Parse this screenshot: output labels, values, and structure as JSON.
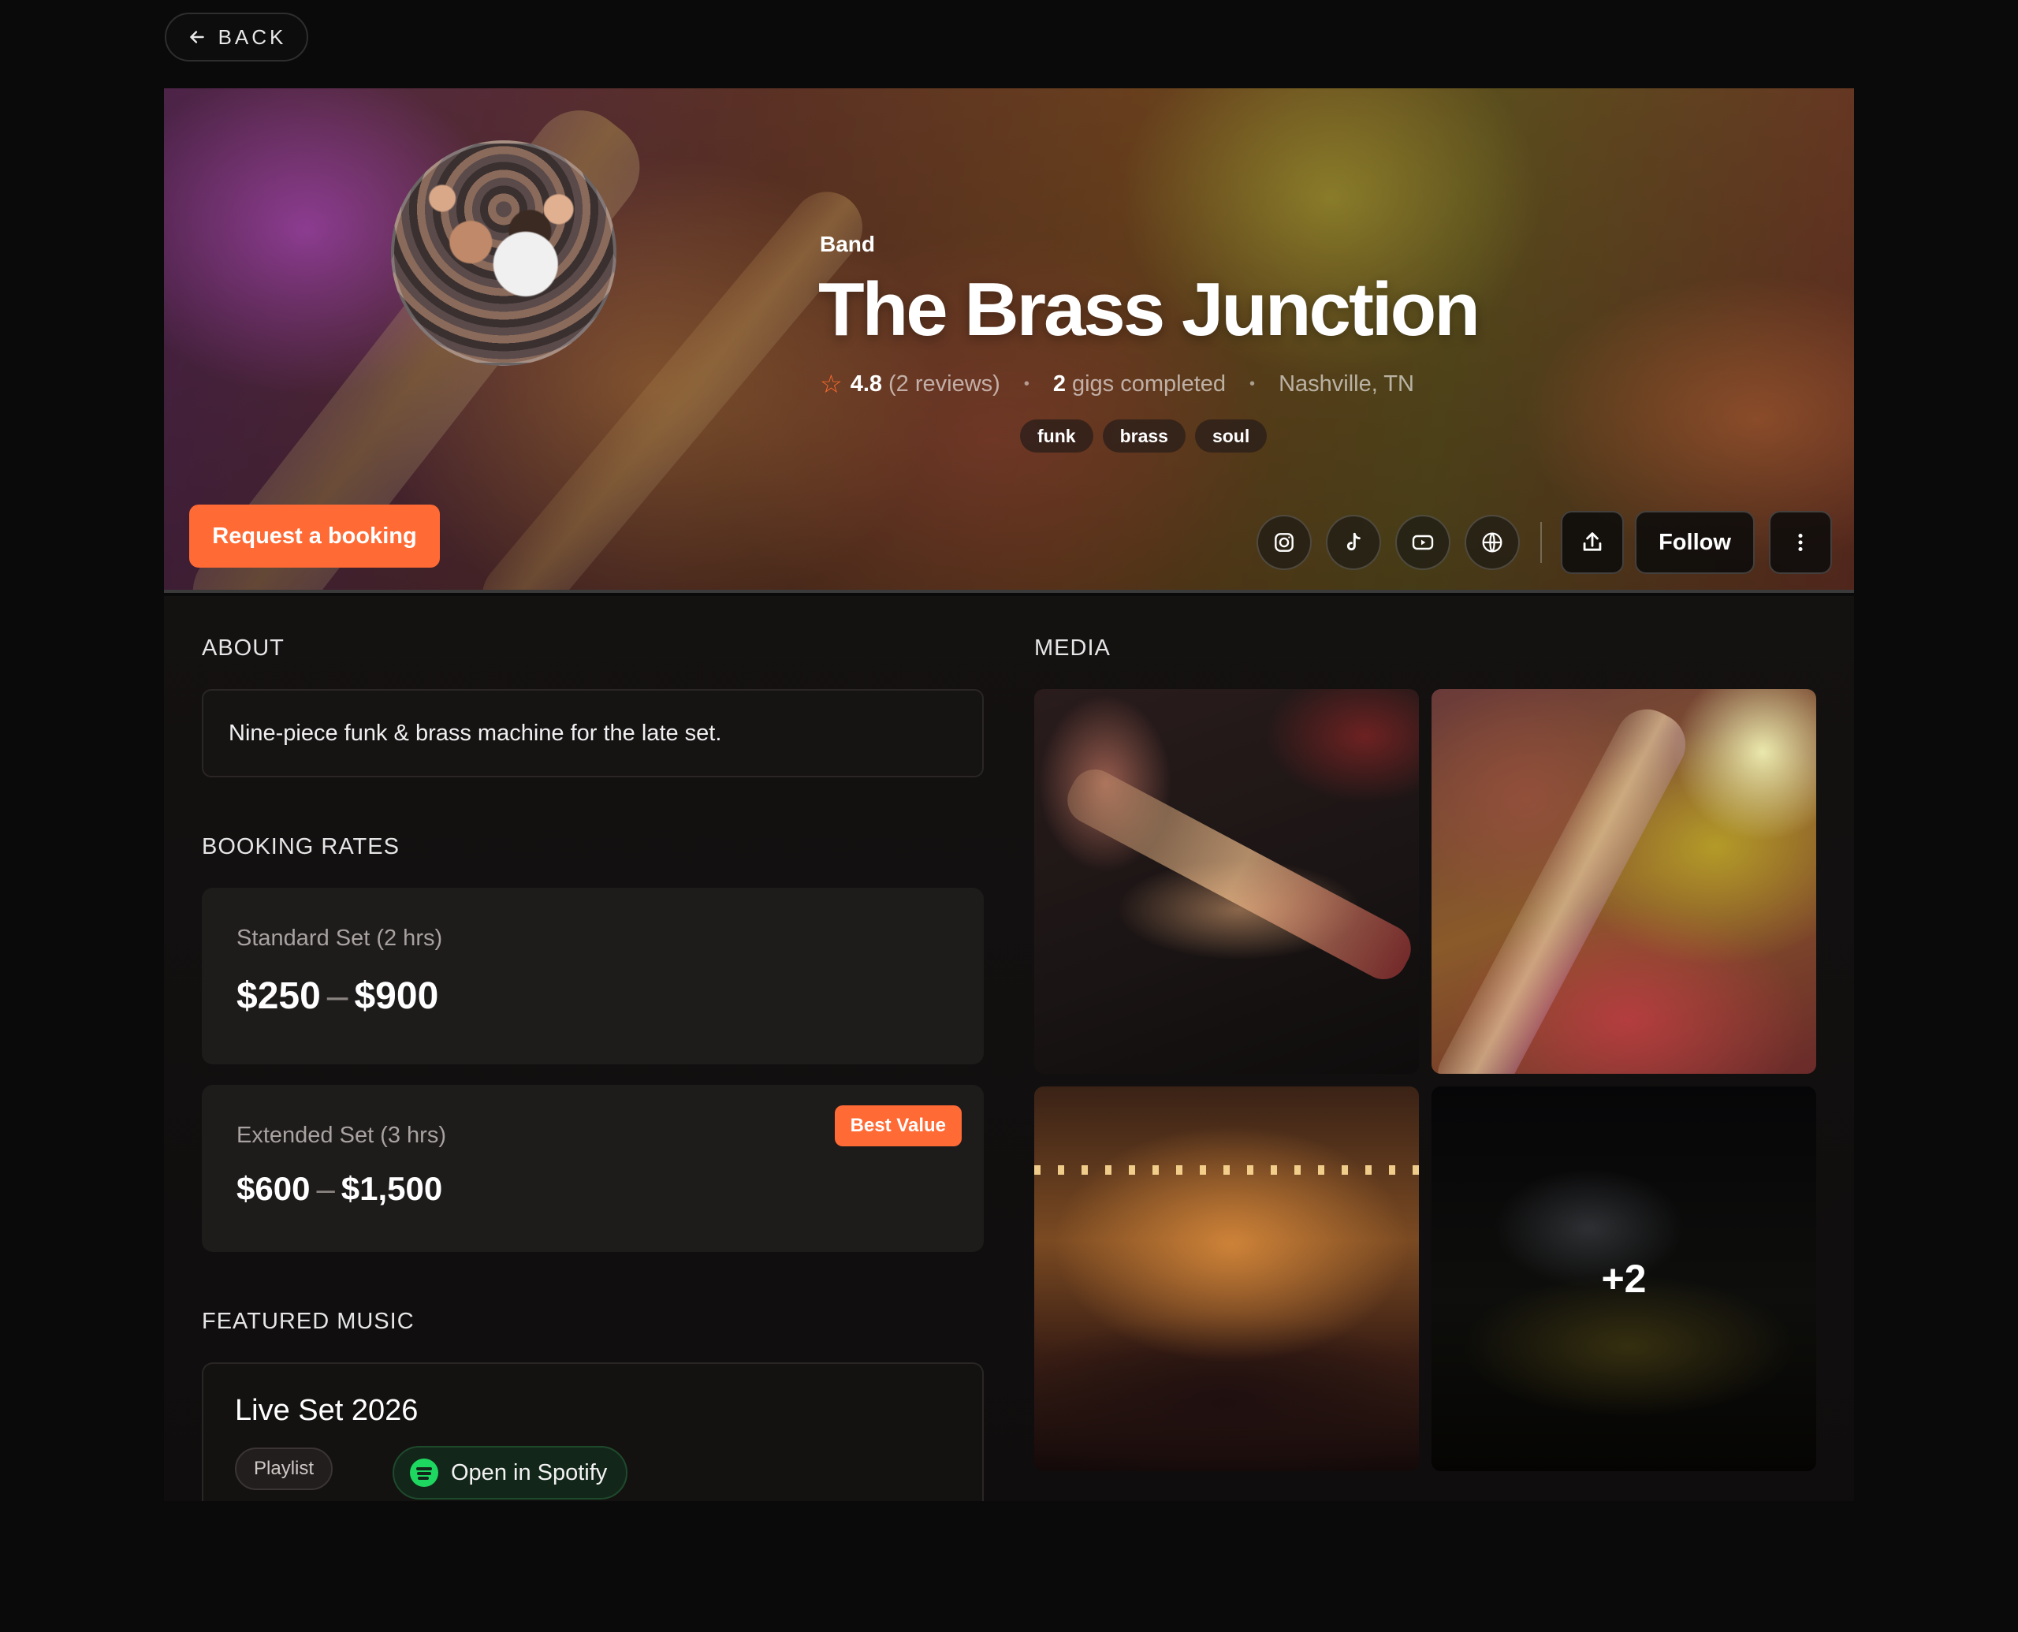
{
  "back_label": "BACK",
  "artist": {
    "category": "Band",
    "name": "The Brass Junction",
    "rating": "4.8",
    "reviews": "(2 reviews)",
    "gigs_count": "2",
    "gigs_label": "gigs completed",
    "location": "Nashville, TN",
    "tags": [
      "funk",
      "brass",
      "soul"
    ]
  },
  "hero_actions": {
    "request_booking": "Request a booking",
    "follow": "Follow",
    "social_icons": [
      "instagram-icon",
      "tiktok-icon",
      "youtube-icon",
      "globe-icon"
    ],
    "share_icon": "share-icon",
    "more_icon": "more-vertical-icon"
  },
  "about": {
    "label": "ABOUT",
    "text": "Nine-piece funk & brass machine for the late set."
  },
  "rates": {
    "label": "BOOKING RATES",
    "items": [
      {
        "name": "Standard Set (2 hrs)",
        "min": "$250",
        "dash": "–",
        "max": "$900"
      },
      {
        "name": "Extended Set (3 hrs)",
        "min": "$600",
        "dash": "–",
        "max": "$1,500",
        "badge": "Best Value"
      }
    ]
  },
  "music": {
    "label": "FEATURED MUSIC",
    "title": "Live Set 2026",
    "type": "Playlist",
    "spotify": "Open in Spotify"
  },
  "media": {
    "label": "MEDIA",
    "more_count": "+2"
  },
  "colors": {
    "accent": "#ff6a35",
    "background": "#0a0a0a",
    "spotify_green": "#1ed760"
  }
}
